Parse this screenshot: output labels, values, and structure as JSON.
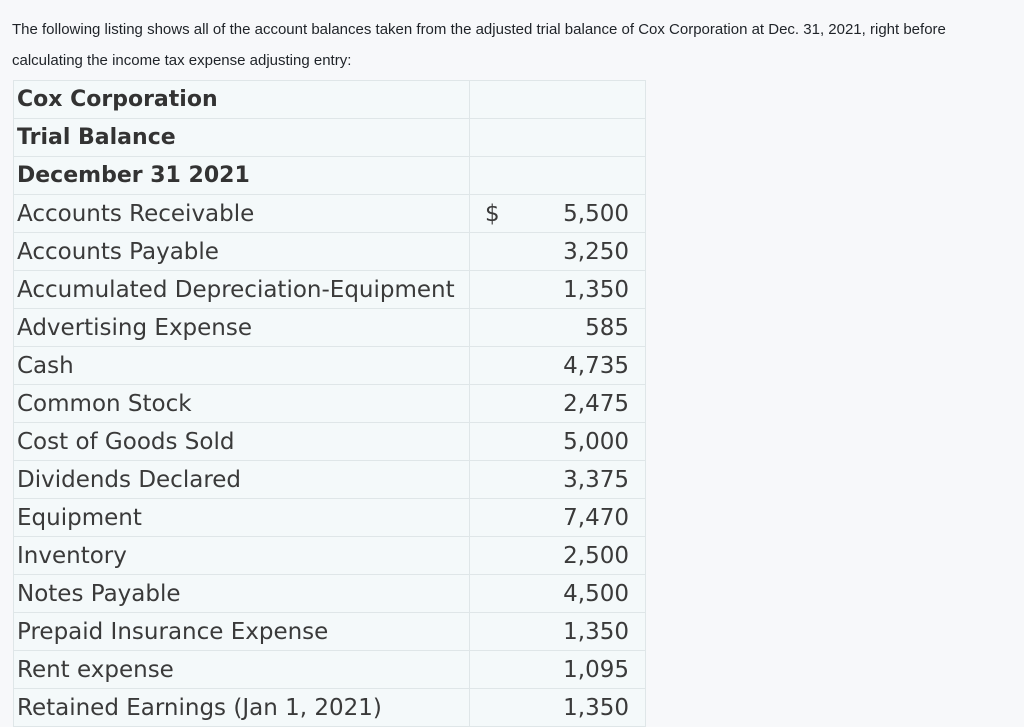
{
  "intro": "The following listing shows all of the account balances taken from the adjusted trial balance of Cox Corporation at Dec. 31, 2021, right before calculating the income tax expense adjusting entry:",
  "table": {
    "headers": [
      "Cox Corporation",
      "Trial Balance",
      "December 31 2021"
    ],
    "currency_symbol": "$",
    "rows": [
      {
        "account": "Accounts Receivable",
        "amount": "5,500"
      },
      {
        "account": "Accounts Payable",
        "amount": "3,250"
      },
      {
        "account": "Accumulated Depreciation-Equipment",
        "amount": "1,350"
      },
      {
        "account": "Advertising Expense",
        "amount": "585"
      },
      {
        "account": "Cash",
        "amount": "4,735"
      },
      {
        "account": "Common Stock",
        "amount": "2,475"
      },
      {
        "account": "Cost of Goods Sold",
        "amount": "5,000"
      },
      {
        "account": "Dividends Declared",
        "amount": "3,375"
      },
      {
        "account": "Equipment",
        "amount": "7,470"
      },
      {
        "account": "Inventory",
        "amount": "2,500"
      },
      {
        "account": "Notes Payable",
        "amount": "4,500"
      },
      {
        "account": "Prepaid Insurance Expense",
        "amount": "1,350"
      },
      {
        "account": "Rent expense",
        "amount": "1,095"
      },
      {
        "account": "Retained Earnings (Jan 1, 2021)",
        "amount": "1,350"
      }
    ]
  }
}
